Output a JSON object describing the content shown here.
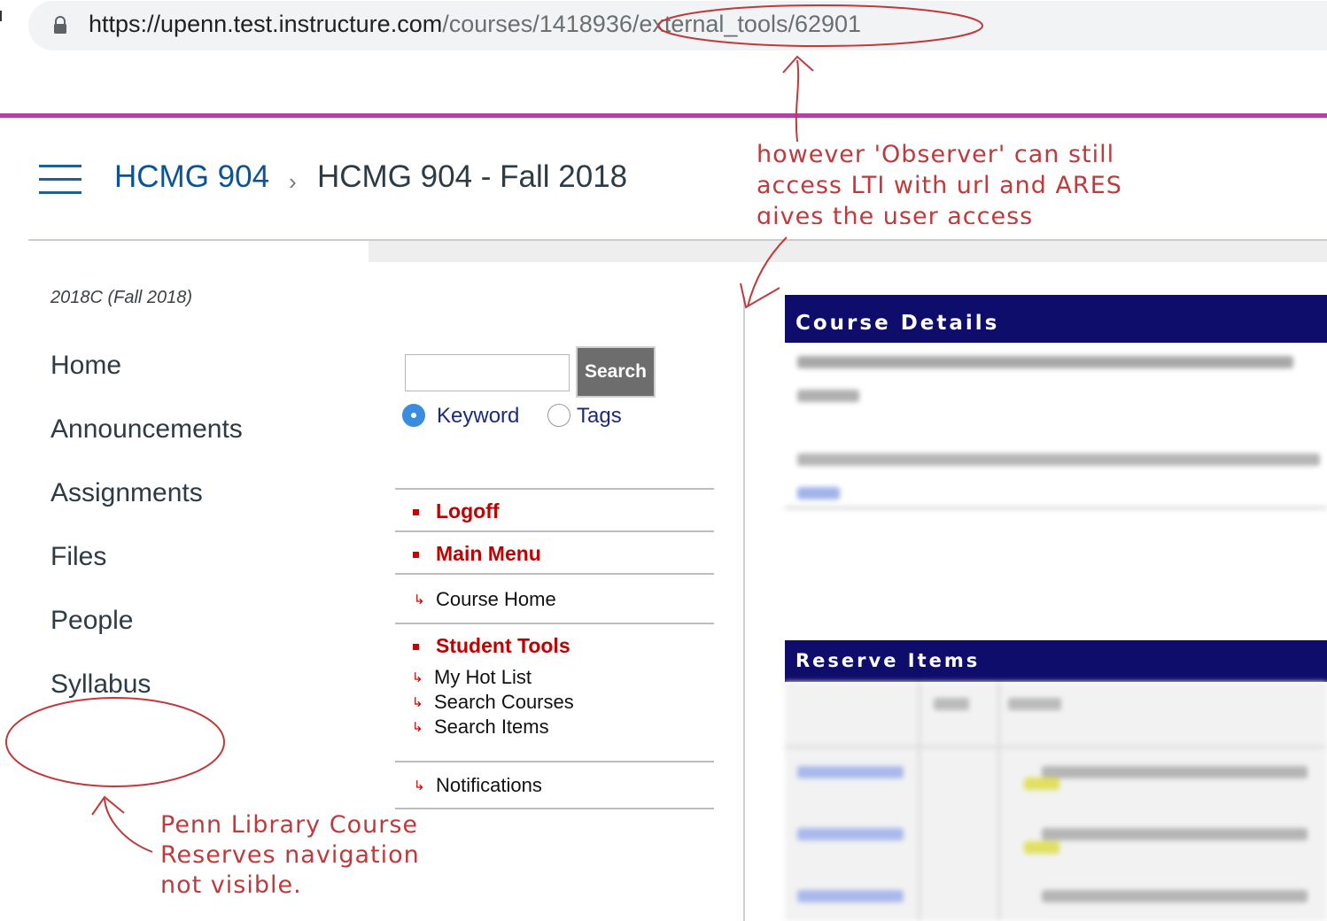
{
  "browser": {
    "url_host": "https://upenn.test.instructure.com",
    "url_path": "/courses/1418936/external_tools/62901"
  },
  "header": {
    "course_code": "HCMG 904",
    "breadcrumb_separator": "›",
    "course_title": "HCMG 904 - Fall 2018"
  },
  "course_nav": {
    "term": "2018C (Fall 2018)",
    "items": [
      "Home",
      "Announcements",
      "Assignments",
      "Files",
      "People",
      "Syllabus"
    ]
  },
  "ares": {
    "search_button": "Search",
    "search_value": "",
    "radio_options": [
      "Keyword",
      "Tags"
    ],
    "selected_radio": "Keyword",
    "menu": {
      "logoff": "Logoff",
      "main_menu": "Main Menu",
      "course_home": "Course Home",
      "student_tools": "Student Tools",
      "my_hot_list": "My Hot List",
      "search_courses": "Search Courses",
      "search_items": "Search Items",
      "notifications": "Notifications"
    },
    "course_details_title": "Course Details",
    "reserve_items_title": "Reserve Items"
  },
  "annotations": {
    "top_lines": [
      "however 'Observer' can still",
      "access LTI with url and ARES",
      "gives the user access"
    ],
    "bottom_lines": [
      "Penn Library Course",
      "Reserves navigation",
      "not visible."
    ]
  },
  "colors": {
    "accent_stripe": "#b53fa8",
    "brand_blue": "#0b5394",
    "panel_header": "#0e0d6b",
    "link_red": "#c00000",
    "annotation_red": "#c0393b"
  }
}
